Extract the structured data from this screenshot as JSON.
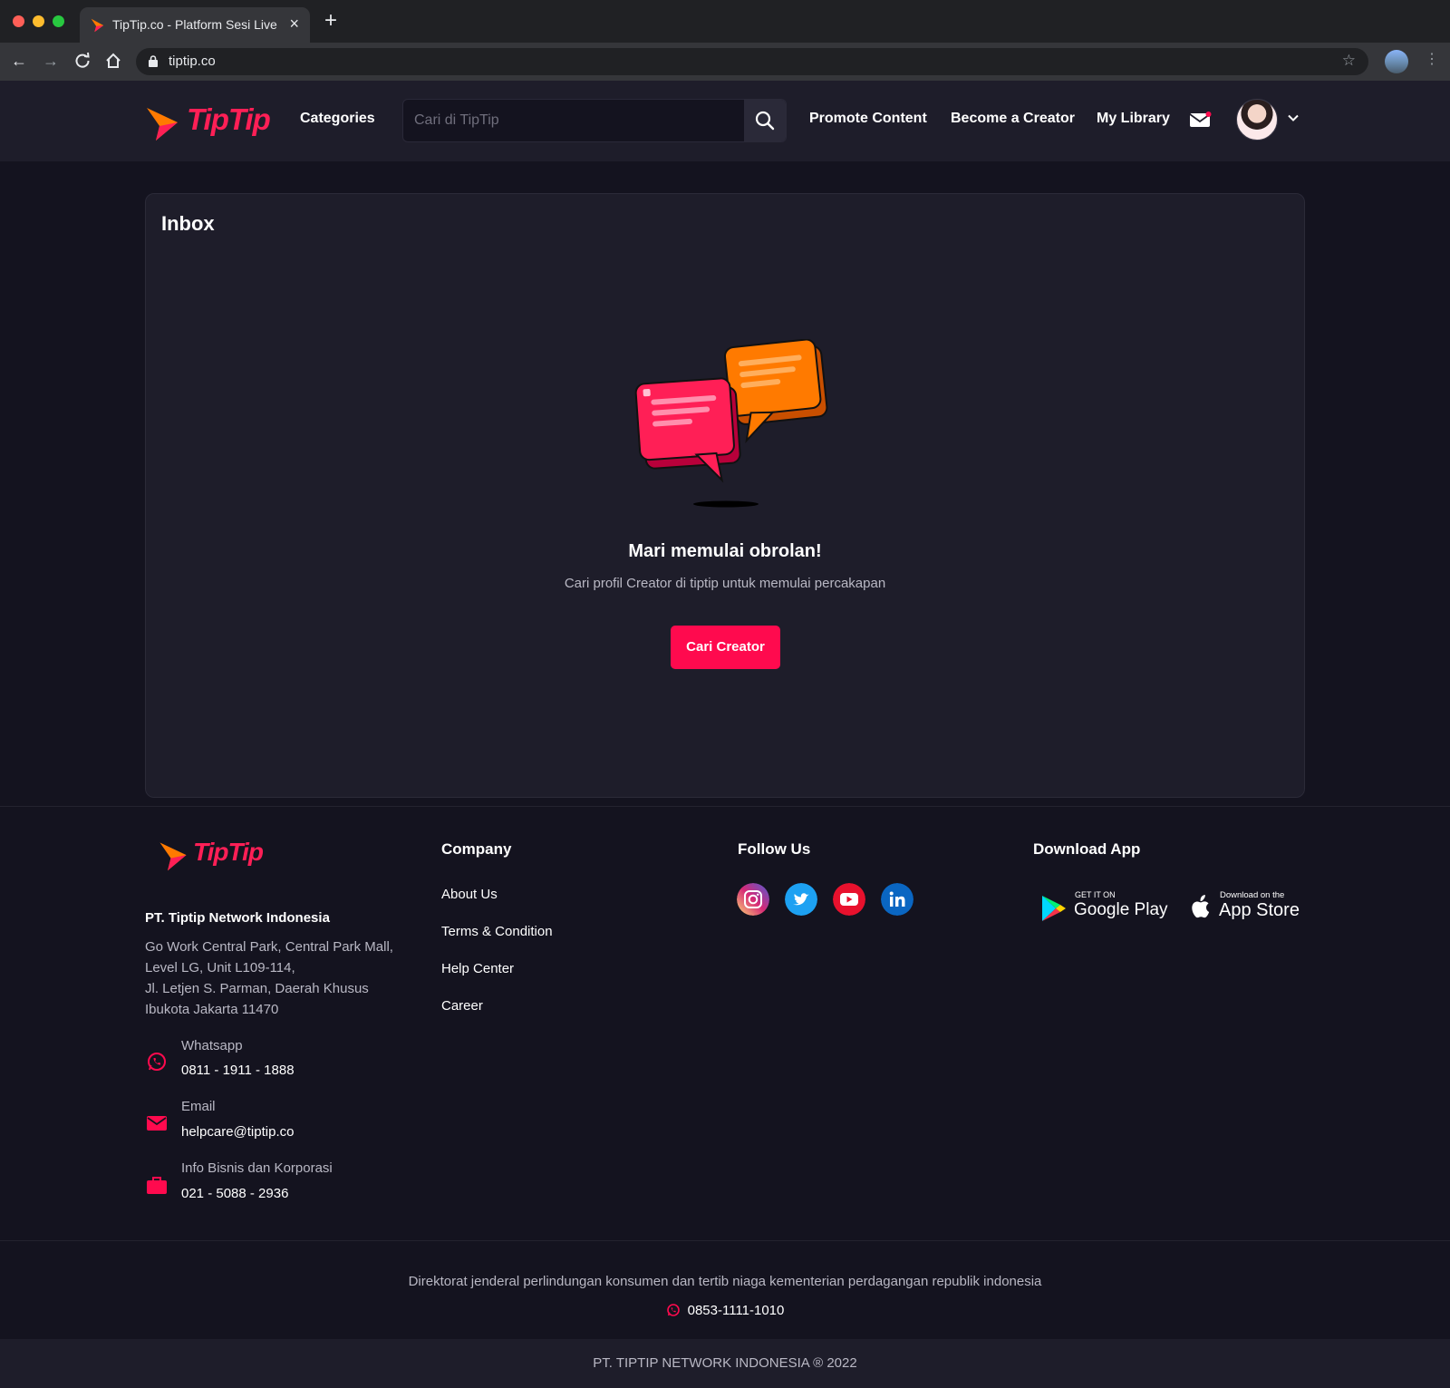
{
  "browser": {
    "tab_title": "TipTip.co - Platform Sesi Live",
    "url": "tiptip.co"
  },
  "header": {
    "logo_text": "TipTip",
    "categories": "Categories",
    "search_placeholder": "Cari di TipTip",
    "promote": "Promote Content",
    "become_creator": "Become a Creator",
    "library": "My Library"
  },
  "inbox": {
    "title": "Inbox",
    "empty_title": "Mari memulai obrolan!",
    "empty_subtitle": "Cari profil Creator di tiptip untuk memulai percakapan",
    "cta": "Cari Creator"
  },
  "footer": {
    "logo_text": "TipTip",
    "company_name": "PT. Tiptip Network Indonesia",
    "address": [
      "Go Work Central Park, Central Park Mall,",
      "Level LG, Unit L109-114,",
      "Jl. Letjen S. Parman, Daerah Khusus",
      "Ibukota Jakarta 11470"
    ],
    "contacts": [
      {
        "label": "Whatsapp",
        "value": "0811 - 1911 - 1888",
        "icon": "whatsapp-icon"
      },
      {
        "label": "Email",
        "value": "helpcare@tiptip.co",
        "icon": "mail-icon"
      },
      {
        "label": "Info Bisnis dan Korporasi",
        "value": "021 - 5088 - 2936",
        "icon": "briefcase-icon"
      }
    ],
    "company_heading": "Company",
    "company_links": [
      "About Us",
      "Terms & Condition",
      "Help Center",
      "Career"
    ],
    "follow_heading": "Follow Us",
    "social": [
      "instagram-icon",
      "twitter-icon",
      "youtube-icon",
      "linkedin-icon"
    ],
    "download_heading": "Download App",
    "google_play": {
      "small": "GET IT ON",
      "big": "Google Play"
    },
    "app_store": {
      "small": "Download on the",
      "big": "App Store"
    },
    "legal_text": "Direktorat jenderal perlindungan konsumen dan tertib niaga kementerian perdagangan republik indonesia",
    "legal_phone": "0853-1111-1010",
    "copyright": "PT. TIPTIP NETWORK INDONESIA ® 2022"
  },
  "colors": {
    "accent": "#ff0a4e",
    "orange": "#ff7a00",
    "background": "#14131f",
    "surface": "#1e1d2a"
  }
}
